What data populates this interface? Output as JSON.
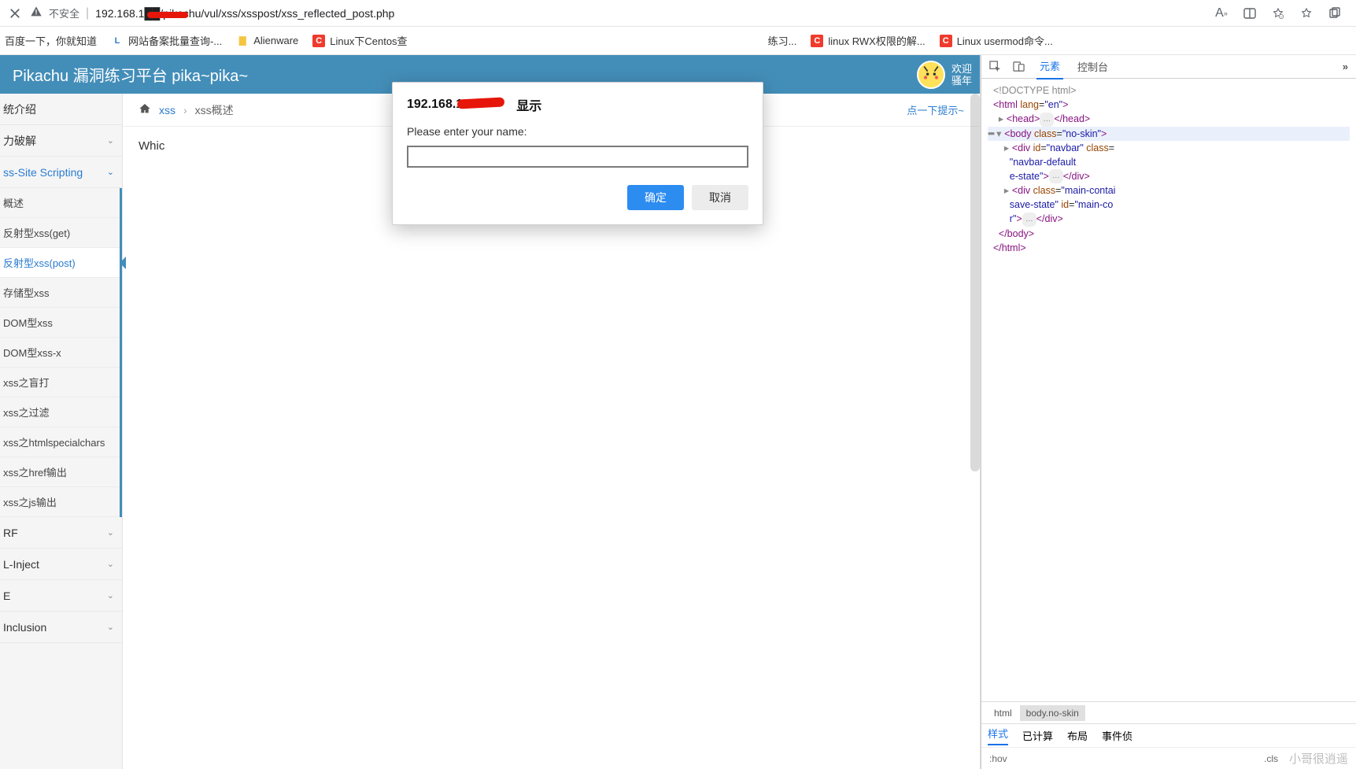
{
  "browser": {
    "close_icon": "close-icon",
    "insecure_label": "不安全",
    "url": "192.168.1██/pikachu/vul/xss/xsspost/xss_reflected_post.php",
    "right_icons": [
      "text-size-icon",
      "translate-icon",
      "favorite-add-icon",
      "star-icon",
      "collections-icon"
    ]
  },
  "bookmarks": [
    {
      "label": "百度一下，你就知道"
    },
    {
      "icon": "L",
      "label": "网站备案批量查询-..."
    },
    {
      "icon": "folder",
      "label": "Alienware"
    },
    {
      "icon": "C",
      "label": "Linux下Centos查"
    },
    {
      "label": "练习..."
    },
    {
      "icon": "C",
      "label": "linux RWX权限的解..."
    },
    {
      "icon": "C",
      "label": "Linux usermod命令..."
    }
  ],
  "header": {
    "title": "Pikachu 漏洞练习平台 pika~pika~",
    "welcome_line1": "欢迎",
    "welcome_line2": "骚年"
  },
  "sidebar": {
    "cats": [
      {
        "label": "统介绍",
        "chev": ""
      },
      {
        "label": "力破解",
        "chev": "⌄"
      }
    ],
    "open_cat": {
      "label": "ss-Site Scripting",
      "chev": "⌄"
    },
    "subs": [
      {
        "label": "概述"
      },
      {
        "label": "反射型xss(get)"
      },
      {
        "label": "反射型xss(post)",
        "active": true
      },
      {
        "label": "存储型xss"
      },
      {
        "label": "DOM型xss"
      },
      {
        "label": "DOM型xss-x"
      },
      {
        "label": "xss之盲打"
      },
      {
        "label": "xss之过滤"
      },
      {
        "label": "xss之htmlspecialchars"
      },
      {
        "label": "xss之href输出"
      },
      {
        "label": "xss之js输出"
      }
    ],
    "tail_cats": [
      {
        "label": "RF",
        "chev": "⌄"
      },
      {
        "label": "L-Inject",
        "chev": "⌄"
      },
      {
        "label": "E",
        "chev": "⌄"
      },
      {
        "label": "Inclusion",
        "chev": "⌄"
      }
    ]
  },
  "breadcrumb": {
    "root": "xss",
    "current": "xss概述",
    "hint": "点一下提示~"
  },
  "content_text": "Whic",
  "modal": {
    "title_prefix": "192.168.1",
    "title_suffix": "显示",
    "label": "Please enter your name:",
    "ok": "确定",
    "cancel": "取消"
  },
  "devtools": {
    "tabs": [
      "元素",
      "控制台"
    ],
    "ic_labels": [
      "inspect-icon",
      "device-icon"
    ],
    "dom_lines": [
      "<!DOCTYPE html>",
      "<html lang=\"en\">",
      "▸ <head>…</head>",
      "▾ <body class=\"no-skin\">",
      "  ▸ <div id=\"navbar\" class=\"navbar-default e-state\">…</div>",
      "  ▸ <div class=\"main-container save-state\" id=\"main-co r\">…</div>",
      "  </body>",
      "</html>"
    ],
    "crumbs": [
      "html",
      "body.no-skin"
    ],
    "style_tabs": [
      "样式",
      "已计算",
      "布局",
      "事件侦"
    ],
    "filter": {
      "hov": ":hov",
      "cls": ".cls"
    },
    "watermark": "小哥很逍遥"
  }
}
